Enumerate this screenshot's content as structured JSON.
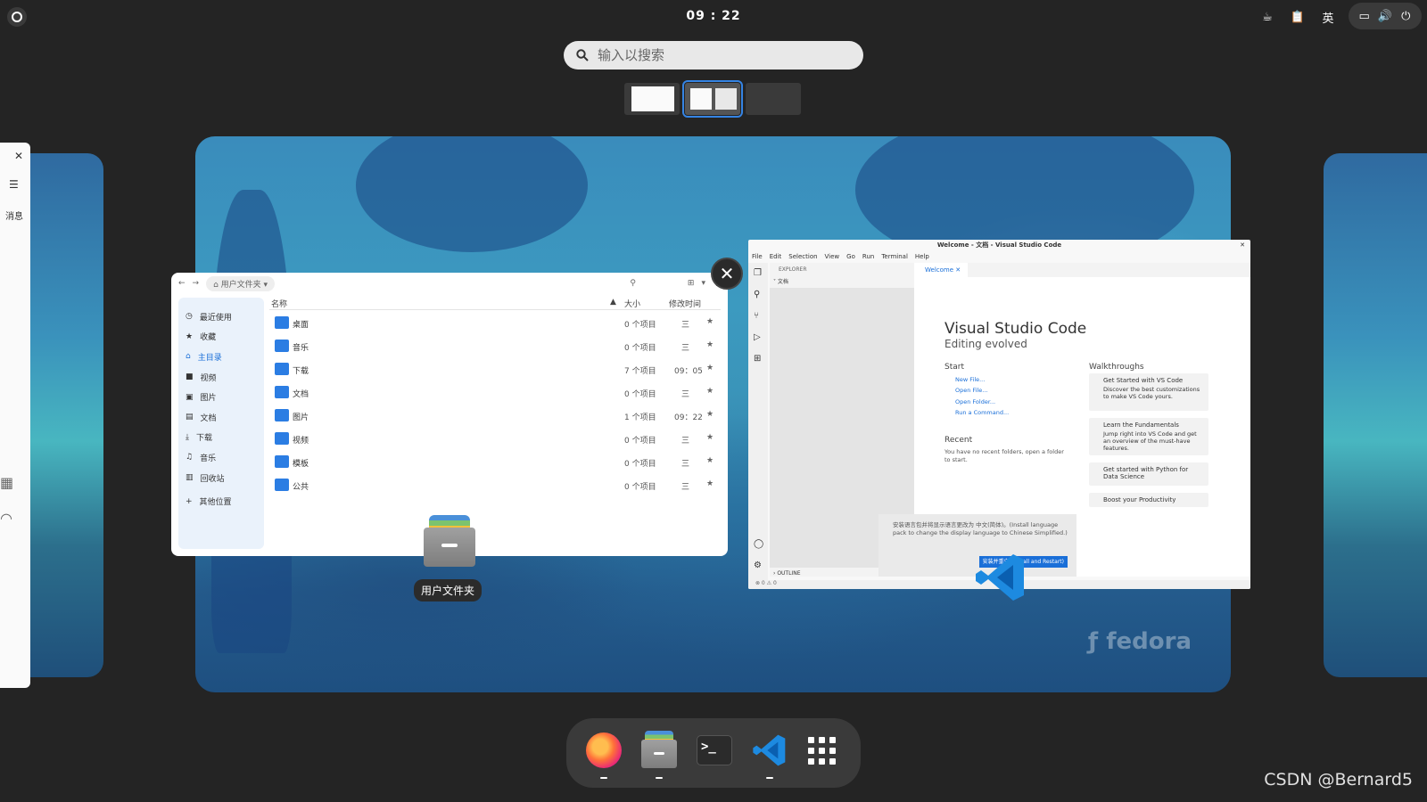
{
  "topbar": {
    "clock": "09 : 22",
    "ime_indicator": "英"
  },
  "search": {
    "placeholder": "输入以搜索"
  },
  "edge_panel": {
    "message_label": "消息"
  },
  "file_manager": {
    "path": "用户文件夹",
    "columns": {
      "name": "名称",
      "size": "大小",
      "modified": "修改时间"
    },
    "sidebar": [
      {
        "label": "最近使用",
        "icon": "clock-icon",
        "active": false
      },
      {
        "label": "收藏",
        "icon": "star-icon",
        "active": false
      },
      {
        "label": "主目录",
        "icon": "home-icon",
        "active": true
      },
      {
        "label": "视频",
        "icon": "video-icon",
        "active": false
      },
      {
        "label": "图片",
        "icon": "image-icon",
        "active": false
      },
      {
        "label": "文档",
        "icon": "document-icon",
        "active": false
      },
      {
        "label": "下载",
        "icon": "download-icon",
        "active": false
      },
      {
        "label": "音乐",
        "icon": "music-icon",
        "active": false
      },
      {
        "label": "回收站",
        "icon": "trash-icon",
        "active": false
      },
      {
        "label": "其他位置",
        "icon": "plus-icon",
        "active": false
      }
    ],
    "rows": [
      {
        "name": "桌面",
        "size": "0 个项目",
        "time": "三"
      },
      {
        "name": "音乐",
        "size": "0 个项目",
        "time": "三"
      },
      {
        "name": "下载",
        "size": "7 个项目",
        "time": "09：05"
      },
      {
        "name": "文档",
        "size": "0 个项目",
        "time": "三"
      },
      {
        "name": "图片",
        "size": "1 个项目",
        "time": "09：22"
      },
      {
        "name": "视频",
        "size": "0 个项目",
        "time": "三"
      },
      {
        "name": "模板",
        "size": "0 个项目",
        "time": "三"
      },
      {
        "name": "公共",
        "size": "0 个项目",
        "time": "三"
      }
    ],
    "app_label": "用户文件夹"
  },
  "vscode": {
    "title": "Welcome - 文档 - Visual Studio Code",
    "menu": [
      "File",
      "Edit",
      "Selection",
      "View",
      "Go",
      "Run",
      "Terminal",
      "Help"
    ],
    "explorer_label": "EXPLORER",
    "folder_label": "文档",
    "outline_label": "OUTLINE",
    "tab_label": "Welcome",
    "heading": "Visual Studio Code",
    "subheading": "Editing evolved",
    "start_label": "Start",
    "start_links": [
      "New File...",
      "Open File...",
      "Open Folder...",
      "Run a Command..."
    ],
    "recent_label": "Recent",
    "recent_text": "You have no recent folders, open a folder to start.",
    "walkthroughs_label": "Walkthroughs",
    "cards": [
      {
        "title": "Get Started with VS Code",
        "desc": "Discover the best customizations to make VS Code yours."
      },
      {
        "title": "Learn the Fundamentals",
        "desc": "Jump right into VS Code and get an overview of the must-have features."
      },
      {
        "title": "Get started with Python for Data Science",
        "desc": ""
      },
      {
        "title": "Boost your Productivity",
        "desc": ""
      }
    ],
    "notification": "安装语言包并将显示语言更改为 中文(简体)。(Install language pack to change the display language to Chinese Simplified.)",
    "notification_button": "安装并重启 (Install and Restart)",
    "status": "⊗ 0 ⚠ 0"
  },
  "watermark": "CSDN @Bernard5",
  "colors": {
    "accent": "#3584e4",
    "panel": "#242424",
    "vscode_blue": "#1a6fd8"
  }
}
